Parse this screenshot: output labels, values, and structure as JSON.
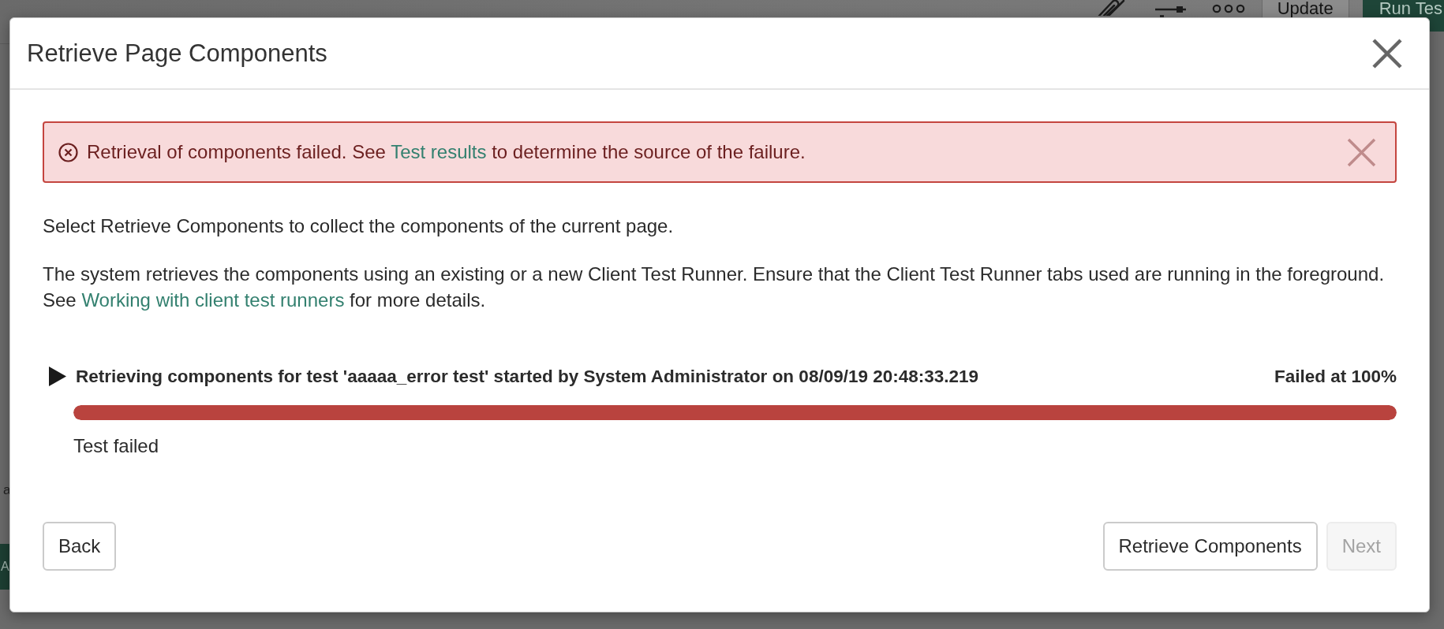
{
  "backdrop": {
    "toolbar_buttons": [
      {
        "label": "Update",
        "kind": "secondary"
      },
      {
        "label": "Run Tes",
        "kind": "primary"
      }
    ],
    "left_edge": [
      {
        "kind": "text",
        "text": "a"
      },
      {
        "kind": "button",
        "text": "A"
      }
    ]
  },
  "dialog": {
    "title": "Retrieve Page Components",
    "alert": {
      "kind": "error",
      "text_before": "Retrieval of components failed. See ",
      "link": "Test results",
      "text_after": " to determine the source of the failure."
    },
    "paragraphs": [
      {
        "text": "Select Retrieve Components to collect the components of the current page."
      },
      {
        "text": "The system retrieves the components using an existing or a new Client Test Runner. Ensure that the Client Test Runner tabs used are running in the foreground. See ",
        "link": "Working with client test runners",
        "text_after": " for more details."
      }
    ],
    "job": {
      "expanded": false,
      "kind": "failed",
      "title": "Retrieving components for test 'aaaaa_error test' started by System Administrator on 08/09/19 20:48:33.219",
      "status": "Failed at 100%",
      "level": 1,
      "result": "Test failed"
    },
    "footer": {
      "left_buttons": [
        {
          "label": "Back",
          "disabled": false
        }
      ],
      "right_buttons": [
        {
          "label": "Retrieve Components",
          "disabled": false
        },
        {
          "label": "Next",
          "disabled": true
        }
      ]
    }
  }
}
